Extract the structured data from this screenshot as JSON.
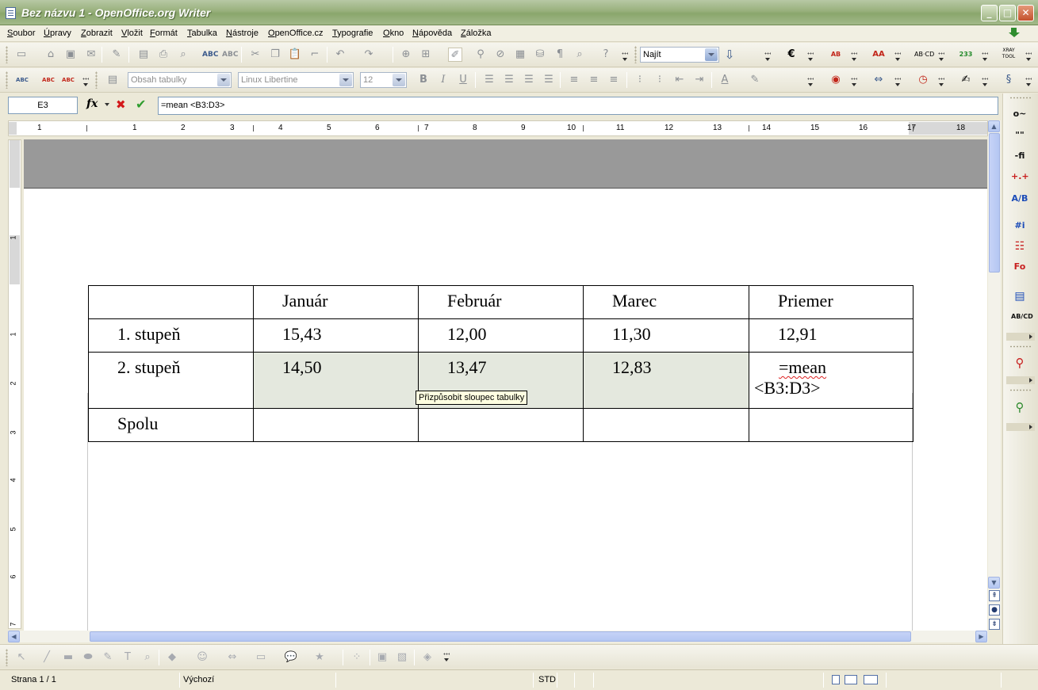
{
  "window": {
    "title": "Bez názvu 1 - OpenOffice.org Writer",
    "controls": {
      "minimize": "_",
      "maximize": "□",
      "close": "✕"
    }
  },
  "menu": [
    "Soubor",
    "Úpravy",
    "Zobrazit",
    "Vložit",
    "Formát",
    "Tabulka",
    "Nástroje",
    "OpenOffice.cz",
    "Typografie",
    "Okno",
    "Nápověda",
    "Záložka"
  ],
  "toolbar": {
    "find_placeholder": "Najít",
    "paragraph_style": "Obsah tabulky",
    "font_name": "Linux Libertine",
    "font_size": "12",
    "bold": "B",
    "italic": "I",
    "underline": "U"
  },
  "formula_bar": {
    "cell_ref": "E3",
    "fx": "fx",
    "cancel": "✖",
    "accept": "✔",
    "formula": "=mean <B3:D3>"
  },
  "ruler": {
    "h_labels": [
      "1",
      "1",
      "2",
      "3",
      "4",
      "5",
      "6",
      "7",
      "8",
      "9",
      "10",
      "11",
      "12",
      "13",
      "14",
      "15",
      "16",
      "17",
      "18"
    ],
    "v_labels": [
      "1",
      "1",
      "2",
      "3",
      "4",
      "5",
      "6",
      "7"
    ]
  },
  "table": {
    "header": [
      "",
      "Január",
      "Február",
      "Marec",
      "Priemer"
    ],
    "rows": [
      [
        "1. stupeň",
        "15,43",
        "12,00",
        "11,30",
        "12,91"
      ],
      [
        "2. stupeň",
        "14,50",
        "13,47",
        "12,83",
        "=mean <B3:D3>"
      ],
      [
        "Spolu",
        "",
        "",
        "",
        ""
      ]
    ],
    "formula_line1": "=mean",
    "formula_line2": "<B3:D3>"
  },
  "tooltip": "Přizpůsobit sloupec tabulky",
  "sidebar": {
    "items": [
      "o~",
      "\"\"",
      "-fi",
      "+.+",
      "A/B",
      "#i",
      "Fo",
      "AB/CD"
    ]
  },
  "status": {
    "page": "Strana 1 / 1",
    "style": "Výchozí",
    "mode": "STD"
  }
}
